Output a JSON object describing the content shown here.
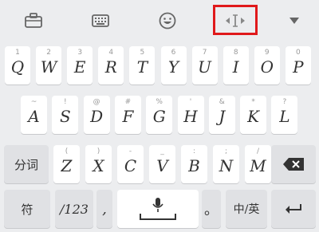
{
  "toolbar": {
    "icons": [
      "briefcase-icon",
      "keyboard-icon",
      "emoji-icon",
      "cursor-icon",
      "collapse-triangle-icon"
    ],
    "accent": "#e0191b"
  },
  "rows": [
    [
      {
        "k": "Q",
        "s": "1"
      },
      {
        "k": "W",
        "s": "2"
      },
      {
        "k": "E",
        "s": "3"
      },
      {
        "k": "R",
        "s": "4"
      },
      {
        "k": "T",
        "s": "5"
      },
      {
        "k": "Y",
        "s": "6"
      },
      {
        "k": "U",
        "s": "7"
      },
      {
        "k": "I",
        "s": "8"
      },
      {
        "k": "O",
        "s": "9"
      },
      {
        "k": "P",
        "s": "0"
      }
    ],
    [
      {
        "k": "A",
        "s": "~"
      },
      {
        "k": "S",
        "s": "!"
      },
      {
        "k": "D",
        "s": "@"
      },
      {
        "k": "F",
        "s": "#"
      },
      {
        "k": "G",
        "s": "%"
      },
      {
        "k": "H",
        "s": "'"
      },
      {
        "k": "J",
        "s": "&"
      },
      {
        "k": "K",
        "s": "*"
      },
      {
        "k": "L",
        "s": "?"
      }
    ],
    [
      {
        "k": "Z",
        "s": "("
      },
      {
        "k": "X",
        "s": ")"
      },
      {
        "k": "C",
        "s": "-"
      },
      {
        "k": "V",
        "s": "_"
      },
      {
        "k": "B",
        "s": ":"
      },
      {
        "k": "N",
        "s": ";"
      },
      {
        "k": "M",
        "s": "/"
      }
    ]
  ],
  "keys": {
    "fenci": "分词",
    "fu": "符",
    "num": "/123",
    "comma": ",",
    "period": "。",
    "lang": "中/英"
  }
}
